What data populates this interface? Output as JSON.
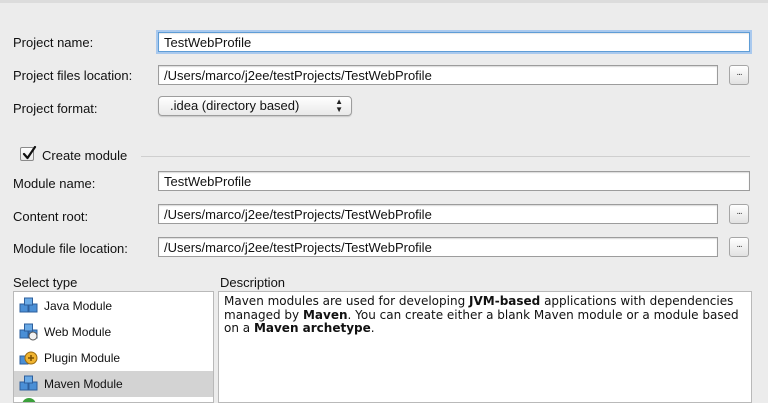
{
  "project": {
    "name_label": "Project name:",
    "name_value": "TestWebProfile",
    "location_label": "Project files location:",
    "location_value": "/Users/marco/j2ee/testProjects/TestWebProfile",
    "format_label": "Project format:",
    "format_value": ".idea (directory based)",
    "browse_label": "..."
  },
  "module": {
    "create_label": "Create module",
    "create_checked": true,
    "name_label": "Module name:",
    "name_value": "TestWebProfile",
    "content_root_label": "Content root:",
    "content_root_value": "/Users/marco/j2ee/testProjects/TestWebProfile",
    "file_location_label": "Module file location:",
    "file_location_value": "/Users/marco/j2ee/testProjects/TestWebProfile"
  },
  "select_type": {
    "heading": "Select type",
    "items": [
      {
        "label": "Java Module",
        "icon": "java-module-icon",
        "selected": false
      },
      {
        "label": "Web Module",
        "icon": "web-module-icon",
        "selected": false
      },
      {
        "label": "Plugin Module",
        "icon": "plugin-module-icon",
        "selected": false
      },
      {
        "label": "Maven Module",
        "icon": "maven-module-icon",
        "selected": true
      }
    ]
  },
  "description": {
    "heading": "Description",
    "parts": [
      {
        "text": "Maven modules are used for developing ",
        "bold": false
      },
      {
        "text": "JVM-based",
        "bold": true
      },
      {
        "text": " applications with dependencies managed by ",
        "bold": false
      },
      {
        "text": "Maven",
        "bold": true
      },
      {
        "text": ". You can create either a blank Maven module or a module based on a ",
        "bold": false
      },
      {
        "text": "Maven archetype",
        "bold": true
      },
      {
        "text": ".",
        "bold": false
      }
    ]
  },
  "colors": {
    "window_bg": "#ececec",
    "focus_ring": "#a9c9ee",
    "selected_row": "#d3d3d3"
  }
}
